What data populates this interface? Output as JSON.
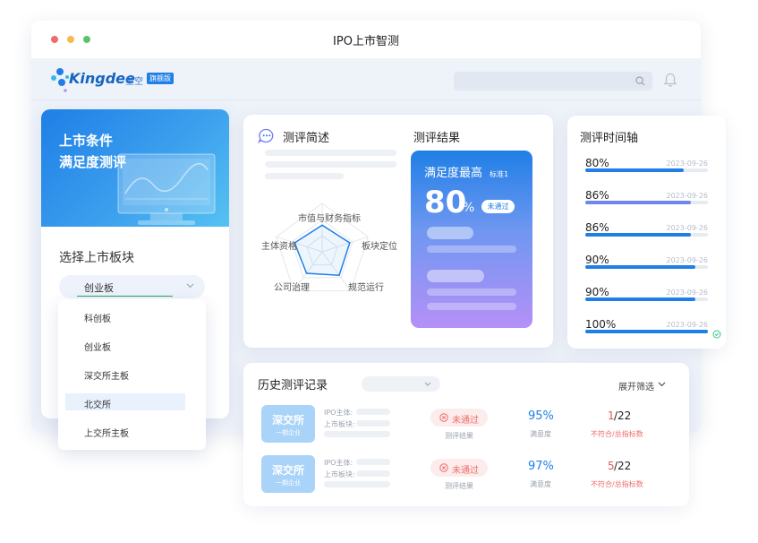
{
  "window": {
    "title": "IPO上市智测"
  },
  "brand": {
    "name": "Kingdee",
    "product": "星空",
    "edition": "旗舰版"
  },
  "search": {
    "placeholder": ""
  },
  "left_panel": {
    "banner_line1": "上市条件",
    "banner_line2": "满足度测评",
    "select_title": "选择上市板块",
    "selected": "创业板",
    "options": [
      "科创板",
      "创业板",
      "深交所主板",
      "北交所",
      "上交所主板"
    ],
    "highlighted_option": "北交所"
  },
  "summary": {
    "title": "测评简述",
    "radar_axes": [
      "市值与财务指标",
      "板块定位",
      "规范运行",
      "公司治理",
      "主体资格"
    ],
    "radar_values": [
      0.55,
      0.6,
      0.6,
      0.55,
      0.6
    ]
  },
  "result": {
    "title": "测评结果",
    "heading": "满足度最高",
    "standard": "标准1",
    "value": "80",
    "unit": "%",
    "status": "未通过"
  },
  "timeline": {
    "title": "测评时间轴",
    "items": [
      {
        "value": "80%",
        "date": "2023-09-26",
        "fill": 0.8,
        "color": "#1f7fe6"
      },
      {
        "value": "86%",
        "date": "2023-09-26",
        "fill": 0.86,
        "color": "#6f86ec"
      },
      {
        "value": "86%",
        "date": "2023-09-26",
        "fill": 0.86,
        "color": "#1f7fe6"
      },
      {
        "value": "90%",
        "date": "2023-09-26",
        "fill": 0.9,
        "color": "#1f7fe6"
      },
      {
        "value": "90%",
        "date": "2023-09-26",
        "fill": 0.9,
        "color": "#1f7fe6"
      },
      {
        "value": "100%",
        "date": "2023-09-26",
        "fill": 1.0,
        "color": "#1f7fe6"
      }
    ]
  },
  "history": {
    "title": "历史测评记录",
    "filter_label": "展开筛选",
    "rows": [
      {
        "tile_title": "深交所",
        "tile_sub": "一期企业",
        "ipo_label": "IPO主体:",
        "board_label": "上市板块:",
        "status": "未通过",
        "status_caption": "测评结果",
        "pct": "95%",
        "pct_caption": "满意度",
        "fail_count": "1",
        "total": "/22",
        "count_caption": "不符合/总指标数"
      },
      {
        "tile_title": "深交所",
        "tile_sub": "一期企业",
        "ipo_label": "IPO主体:",
        "board_label": "上市板块:",
        "status": "未通过",
        "status_caption": "测评结果",
        "pct": "97%",
        "pct_caption": "满意度",
        "fail_count": "5",
        "total": "/22",
        "count_caption": "不符合/总指标数"
      }
    ]
  },
  "colors": {
    "accent": "#1f7fe6",
    "fail": "#f06b6b",
    "purple": "#b590f7"
  }
}
